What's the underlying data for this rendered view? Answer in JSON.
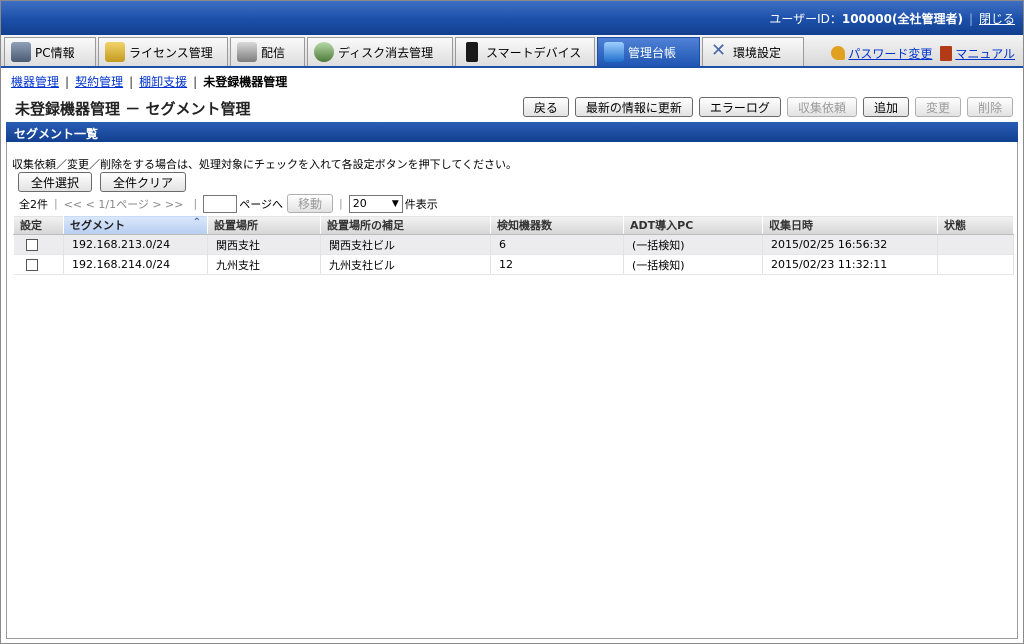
{
  "topbar": {
    "user_label": "ユーザーID：",
    "user_value": "100000(全社管理者)",
    "close_link": "閉じる"
  },
  "tabs": [
    {
      "label": "PC情報",
      "icon": "pc-icon"
    },
    {
      "label": "ライセンス管理",
      "icon": "license-icon"
    },
    {
      "label": "配信",
      "icon": "distribution-icon"
    },
    {
      "label": "ディスク消去管理",
      "icon": "disk-erase-icon"
    },
    {
      "label": "スマートデバイス",
      "icon": "smart-device-icon"
    },
    {
      "label": "管理台帳",
      "icon": "ledger-icon",
      "active": true
    },
    {
      "label": "環境設定",
      "icon": "settings-icon"
    }
  ],
  "links": {
    "password_change": "パスワード変更",
    "manual": "マニュアル"
  },
  "breadcrumb": {
    "items": [
      "機器管理",
      "契約管理",
      "棚卸支援"
    ],
    "current": "未登録機器管理"
  },
  "page_title": "未登録機器管理 － セグメント管理",
  "actions": {
    "back": "戻る",
    "refresh": "最新の情報に更新",
    "error_log": "エラーログ",
    "collect_request": "収集依頼",
    "add": "追加",
    "change": "変更",
    "delete": "削除"
  },
  "section_title": "セグメント一覧",
  "instruction": "収集依頼／変更／削除をする場合は、処理対象にチェックを入れて各設定ボタンを押下してください。",
  "selection": {
    "select_all": "全件選択",
    "clear_all": "全件クリア"
  },
  "pager": {
    "total": "全2件",
    "nav": "<< < 1/1ページ > >>",
    "page_suffix": "ページへ",
    "move": "移動",
    "per_page": "20",
    "per_page_suffix": "件表示"
  },
  "table": {
    "headers": [
      "設定",
      "セグメント",
      "設置場所",
      "設置場所の補足",
      "検知機器数",
      "ADT導入PC",
      "収集日時",
      "状態"
    ],
    "rows": [
      {
        "segment": "192.168.213.0/24",
        "location": "関西支社",
        "location_note": "関西支社ビル",
        "count": "6",
        "adt": "(一括検知)",
        "collected": "2015/02/25 16:56:32",
        "status": ""
      },
      {
        "segment": "192.168.214.0/24",
        "location": "九州支社",
        "location_note": "九州支社ビル",
        "count": "12",
        "adt": "(一括検知)",
        "collected": "2015/02/23 11:32:11",
        "status": ""
      }
    ]
  },
  "colors": {
    "header_blue": "#1b4fa8",
    "link_blue": "#0033cc",
    "active_tab": "#1f56b3"
  }
}
